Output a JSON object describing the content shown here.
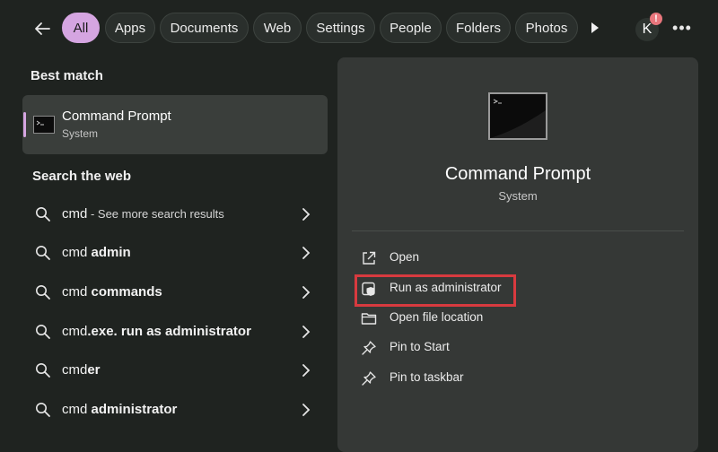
{
  "filters": {
    "tabs": [
      {
        "label": "All",
        "active": true
      },
      {
        "label": "Apps"
      },
      {
        "label": "Documents"
      },
      {
        "label": "Web"
      },
      {
        "label": "Settings"
      },
      {
        "label": "People"
      },
      {
        "label": "Folders"
      },
      {
        "label": "Photos"
      }
    ]
  },
  "account": {
    "initial": "K",
    "badge": "!"
  },
  "more_label": "•••",
  "left": {
    "best_match_heading": "Best match",
    "best_match": {
      "title": "Command Prompt",
      "subtitle": "System",
      "icon": "terminal-icon"
    },
    "search_web_heading": "Search the web",
    "web_results": [
      {
        "query": "cmd",
        "suffix": "",
        "hint": " - See more search results"
      },
      {
        "query": "cmd ",
        "suffix": "admin",
        "hint": ""
      },
      {
        "query": "cmd ",
        "suffix": "commands",
        "hint": ""
      },
      {
        "query": "cmd",
        "suffix": ".exe. run as administrator",
        "hint": ""
      },
      {
        "query": "cmd",
        "suffix": "er",
        "hint": ""
      },
      {
        "query": "cmd ",
        "suffix": "administrator",
        "hint": ""
      }
    ]
  },
  "right": {
    "app_title": "Command Prompt",
    "app_subtitle": "System",
    "actions": [
      {
        "label": "Open",
        "icon": "open-external-icon"
      },
      {
        "label": "Run as administrator",
        "icon": "shield-admin-icon",
        "highlighted": true
      },
      {
        "label": "Open file location",
        "icon": "folder-icon"
      },
      {
        "label": "Pin to Start",
        "icon": "pin-icon"
      },
      {
        "label": "Pin to taskbar",
        "icon": "pin-icon"
      }
    ]
  },
  "colors": {
    "accent": "#d5a5e1",
    "highlight": "#d83a3f",
    "background": "#1f2320",
    "panel": "#353836"
  }
}
